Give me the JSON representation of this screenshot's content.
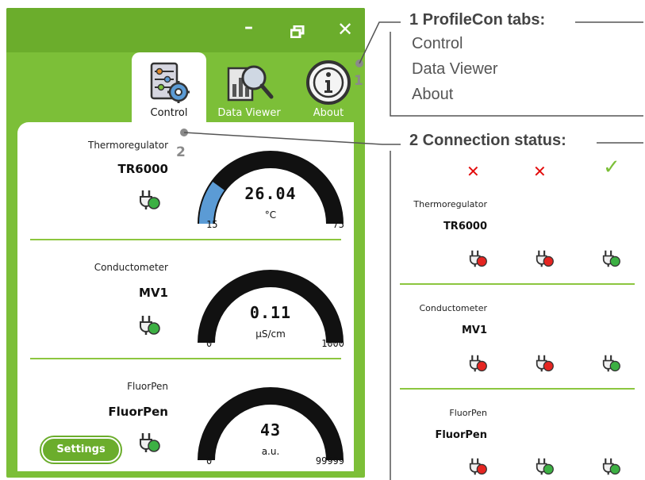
{
  "window": {
    "controls": {
      "minimize": "–",
      "close": "✕"
    },
    "tabs": [
      {
        "label": "Control",
        "icon": "control-panel-icon",
        "active": true
      },
      {
        "label": "Data Viewer",
        "icon": "data-viewer-icon",
        "active": false
      },
      {
        "label": "About",
        "icon": "info-icon",
        "active": false
      }
    ]
  },
  "callouts": {
    "one": "1",
    "two": "2"
  },
  "devices": [
    {
      "type": "Thermoregulator",
      "name": "TR6000",
      "connected": true,
      "gauge": {
        "value": "26.04",
        "unit": "°C",
        "min": "15",
        "max": "75",
        "level": 0.2
      }
    },
    {
      "type": "Conductometer",
      "name": "MV1",
      "connected": true,
      "gauge": {
        "value": "0.11",
        "unit": "µS/cm",
        "min": "0",
        "max": "1000",
        "level": 0
      }
    },
    {
      "type": "FluorPen",
      "name": "FluorPen",
      "connected": true,
      "settings_label": "Settings",
      "gauge": {
        "value": "43",
        "unit": "a.u.",
        "min": "0",
        "max": "99999",
        "level": 0
      }
    }
  ],
  "annotation": {
    "tabs_title": "1 ProfileCon tabs:",
    "tabs_items": [
      "Control",
      "Data Viewer",
      "About"
    ],
    "status_title": "2 Connection status:",
    "status_marks": [
      "✕",
      "✕",
      "✓"
    ],
    "devices": [
      {
        "type": "Thermoregulator",
        "name": "TR6000",
        "plugs": [
          "red",
          "red",
          "green"
        ]
      },
      {
        "type": "Conductometer",
        "name": "MV1",
        "plugs": [
          "red",
          "red",
          "green"
        ]
      },
      {
        "type": "FluorPen",
        "name": "FluorPen",
        "plugs": [
          "red",
          "green",
          "green"
        ]
      }
    ]
  },
  "colors": {
    "green": "#7cbf38",
    "dark_green": "#6bad2c",
    "status_green": "#3cb043",
    "status_red": "#e52521",
    "gauge_fill": "#5b9bd5",
    "gauge_track": "#111111",
    "cross_red": "#e30b0b"
  }
}
